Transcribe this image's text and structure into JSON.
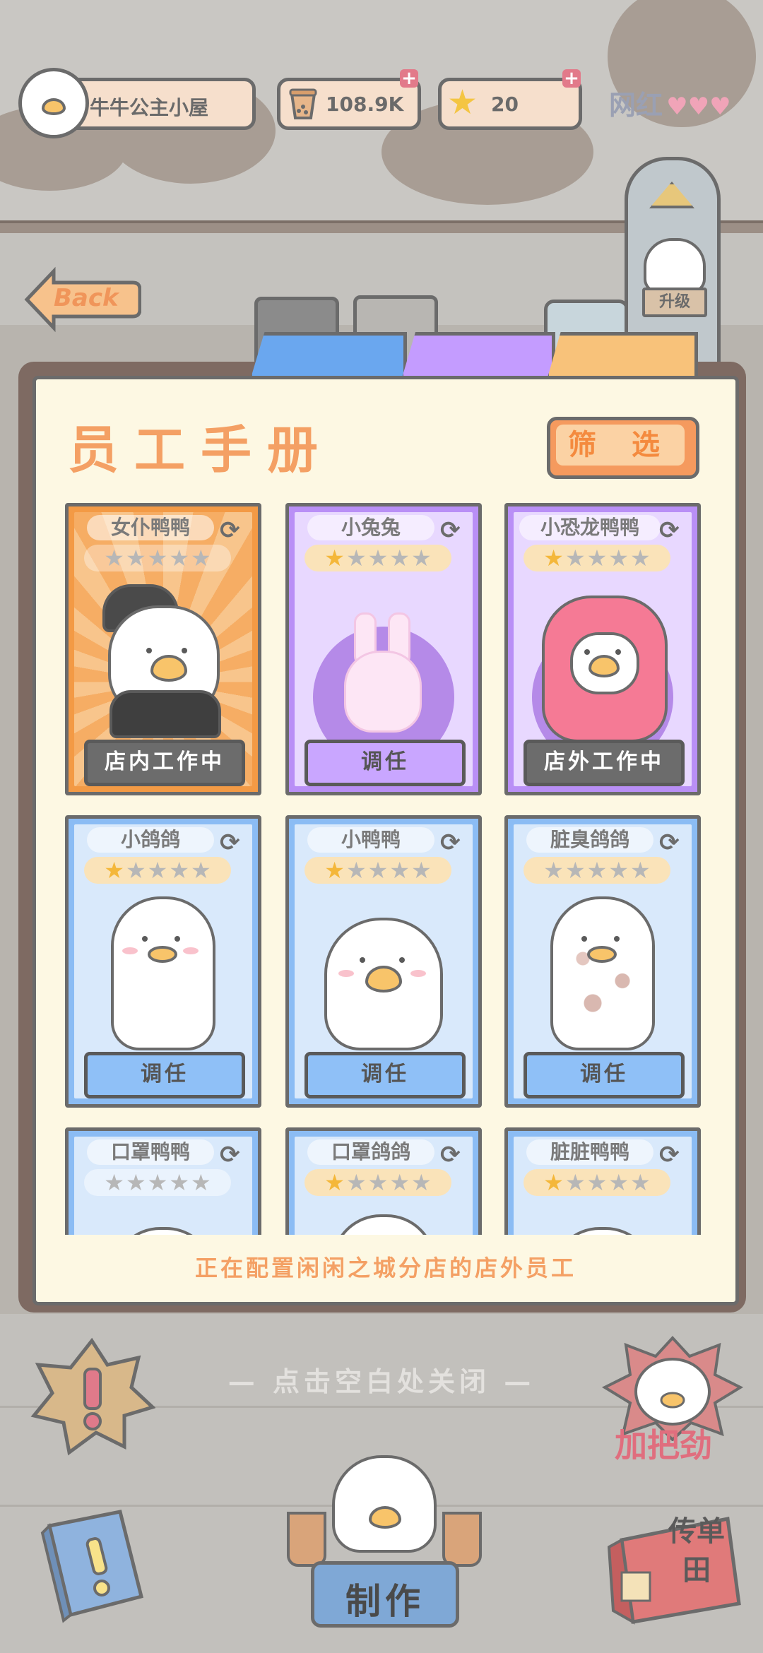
{
  "hud": {
    "shop_name": "牛牛公主小屋",
    "currency": "108.9K",
    "stars": "20",
    "popularity_label": "网红"
  },
  "back_label": "Back",
  "upgrade_label": "升级",
  "tabs": [
    {
      "color": "#6aa7ef"
    },
    {
      "color": "#c49cff"
    },
    {
      "color": "#f8c27a"
    }
  ],
  "book": {
    "title": "员工手册",
    "filter_label": "筛 选",
    "footer": "正在配置闲闲之城分店的店外员工"
  },
  "cards": [
    {
      "name": "女仆鸭鸭",
      "rarity_stars": 0,
      "theme": "orange",
      "status": "店内工作中",
      "button_style": "gray"
    },
    {
      "name": "小兔兔",
      "rarity_stars": 1,
      "theme": "purple",
      "status": "调任",
      "button_style": "purple"
    },
    {
      "name": "小恐龙鸭鸭",
      "rarity_stars": 1,
      "theme": "purple",
      "status": "店外工作中",
      "button_style": "gray"
    },
    {
      "name": "小鸽鸽",
      "rarity_stars": 1,
      "theme": "blue",
      "status": "调任",
      "button_style": "blue"
    },
    {
      "name": "小鸭鸭",
      "rarity_stars": 1,
      "theme": "blue",
      "status": "调任",
      "button_style": "blue"
    },
    {
      "name": "脏臭鸽鸽",
      "rarity_stars": 0,
      "theme": "blue",
      "status": "调任",
      "button_style": "blue"
    },
    {
      "name": "口罩鸭鸭",
      "rarity_stars": 0,
      "theme": "blue",
      "status": "",
      "button_style": "blue"
    },
    {
      "name": "口罩鸽鸽",
      "rarity_stars": 1,
      "theme": "blue",
      "status": "",
      "button_style": "blue"
    },
    {
      "name": "脏脏鸭鸭",
      "rarity_stars": 1,
      "theme": "blue",
      "status": "",
      "button_style": "blue"
    }
  ],
  "close_hint": "— 点击空白处关闭 —",
  "bottom_bar": {
    "cheer_label": "加把劲",
    "make_label": "制作",
    "flyer_label": "传单",
    "flyer_suffix": "田"
  }
}
